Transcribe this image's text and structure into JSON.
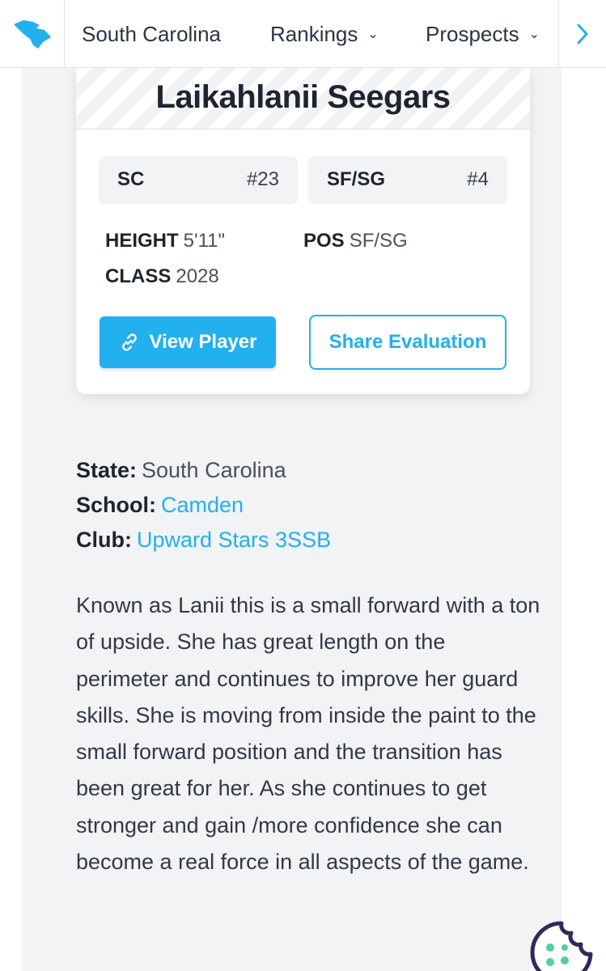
{
  "nav": {
    "logo_icon": "south-carolina-state-icon",
    "items": [
      {
        "label": "South Carolina",
        "dropdown": false
      },
      {
        "label": "Rankings",
        "dropdown": true
      },
      {
        "label": "Prospects",
        "dropdown": true
      }
    ],
    "next_icon": "chevron-right-icon"
  },
  "player": {
    "name": "Laikahlanii Seegars",
    "state_abbr": "SC",
    "state_rank": "#23",
    "position_group": "SF/SG",
    "position_rank": "#4",
    "height_label": "HEIGHT",
    "height": "5'11\"",
    "pos_label": "POS",
    "pos": "SF/SG",
    "class_label": "CLASS",
    "class": "2028",
    "view_button": "View Player",
    "share_button": "Share Evaluation"
  },
  "info": {
    "state_label": "State:",
    "state": "South Carolina",
    "school_label": "School:",
    "school": "Camden",
    "club_label": "Club:",
    "club": "Upward Stars 3SSB"
  },
  "evaluation": "Known as Lanii this is a small forward with a ton of upside. She has great length on the perimeter and continues to improve her guard skills. She is moving from inside the paint to the small forward position and the transition has been great for her. As she continues to get stronger and gain /more confidence she can become a real force in all aspects of the game.",
  "colors": {
    "accent": "#22b0ee",
    "panel_bg": "#f2f3f5",
    "text_dark": "#1f2430"
  },
  "cookie_icon": "cookie-settings-icon"
}
